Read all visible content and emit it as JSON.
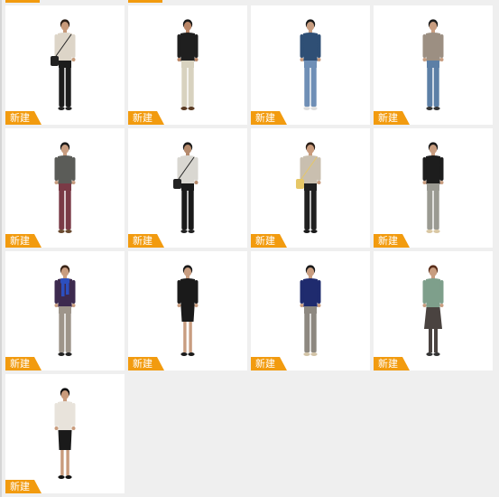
{
  "badge_color": "#f29b0f",
  "cards": [
    {
      "badge": "新建",
      "person": {
        "top": "#ddd5c8",
        "bottom": "#1c1c1c",
        "skin": "#c79a7a",
        "hair": "#2a1e16",
        "shoe": "#222222",
        "accessory": "bag",
        "accessory_color": "#222222"
      }
    },
    {
      "badge": "新建",
      "person": {
        "top": "#1f1f1f",
        "bottom": "#d8d2bf",
        "skin": "#b98566",
        "hair": "#1a1a1a",
        "shoe": "#5a3a22",
        "accessory": "none",
        "accessory_color": ""
      }
    },
    {
      "badge": "新建",
      "person": {
        "top": "#2f4f75",
        "bottom": "#6f8fb6",
        "skin": "#c89d80",
        "hair": "#1a1a1a",
        "shoe": "#dddddd",
        "accessory": "none",
        "accessory_color": ""
      }
    },
    {
      "badge": "新建",
      "person": {
        "top": "#9c8f82",
        "bottom": "#5c7fa6",
        "skin": "#c89d80",
        "hair": "#1a1a1a",
        "shoe": "#333333",
        "accessory": "none",
        "accessory_color": ""
      }
    },
    {
      "badge": "新建",
      "person": {
        "top": "#5b5c58",
        "bottom": "#7a3a46",
        "skin": "#c89d80",
        "hair": "#1a1a1a",
        "shoe": "#6a4a30",
        "accessory": "none",
        "accessory_color": ""
      }
    },
    {
      "badge": "新建",
      "person": {
        "top": "#d9d7d1",
        "bottom": "#1a1a1a",
        "skin": "#b58a6c",
        "hair": "#1a1a1a",
        "shoe": "#222222",
        "accessory": "bag",
        "accessory_color": "#222222"
      }
    },
    {
      "badge": "新建",
      "person": {
        "top": "#c9bfaf",
        "bottom": "#202020",
        "skin": "#c99b7c",
        "hair": "#2a1e16",
        "shoe": "#1a1a1a",
        "accessory": "bag",
        "accessory_color": "#e6c766"
      }
    },
    {
      "badge": "新建",
      "person": {
        "top": "#1d1d1d",
        "bottom": "#9a9a92",
        "skin": "#c89d80",
        "hair": "#1a1a1a",
        "shoe": "#d9c7a3",
        "accessory": "none",
        "accessory_color": ""
      }
    },
    {
      "badge": "新建",
      "person": {
        "top": "#3d2a4f",
        "bottom": "#9e958a",
        "skin": "#c89d80",
        "hair": "#3a2416",
        "shoe": "#222222",
        "accessory": "scarf",
        "accessory_color": "#2c4fbf"
      }
    },
    {
      "badge": "新建",
      "person": {
        "top": "#1a1a1a",
        "bottom": "#1a1a1a",
        "skin": "#c89d80",
        "hair": "#1a1a1a",
        "shoe": "#1a1a1a",
        "accessory": "dress",
        "accessory_color": "#1a1a1a"
      }
    },
    {
      "badge": "新建",
      "person": {
        "top": "#1f2b6e",
        "bottom": "#8d8880",
        "skin": "#c89d80",
        "hair": "#1a1a1a",
        "shoe": "#d2c3a6",
        "accessory": "none",
        "accessory_color": ""
      }
    },
    {
      "badge": "新建",
      "person": {
        "top": "#7e9f8b",
        "bottom": "#4a4340",
        "skin": "#c89d80",
        "hair": "#5a2e1a",
        "shoe": "#333333",
        "accessory": "skirt",
        "accessory_color": "#4a4340"
      }
    },
    {
      "badge": "新建",
      "person": {
        "top": "#e8e3db",
        "bottom": "#1a1a1a",
        "skin": "#c99b7c",
        "hair": "#111111",
        "shoe": "#111111",
        "accessory": "pencil-skirt",
        "accessory_color": "#1a1a1a"
      }
    }
  ]
}
